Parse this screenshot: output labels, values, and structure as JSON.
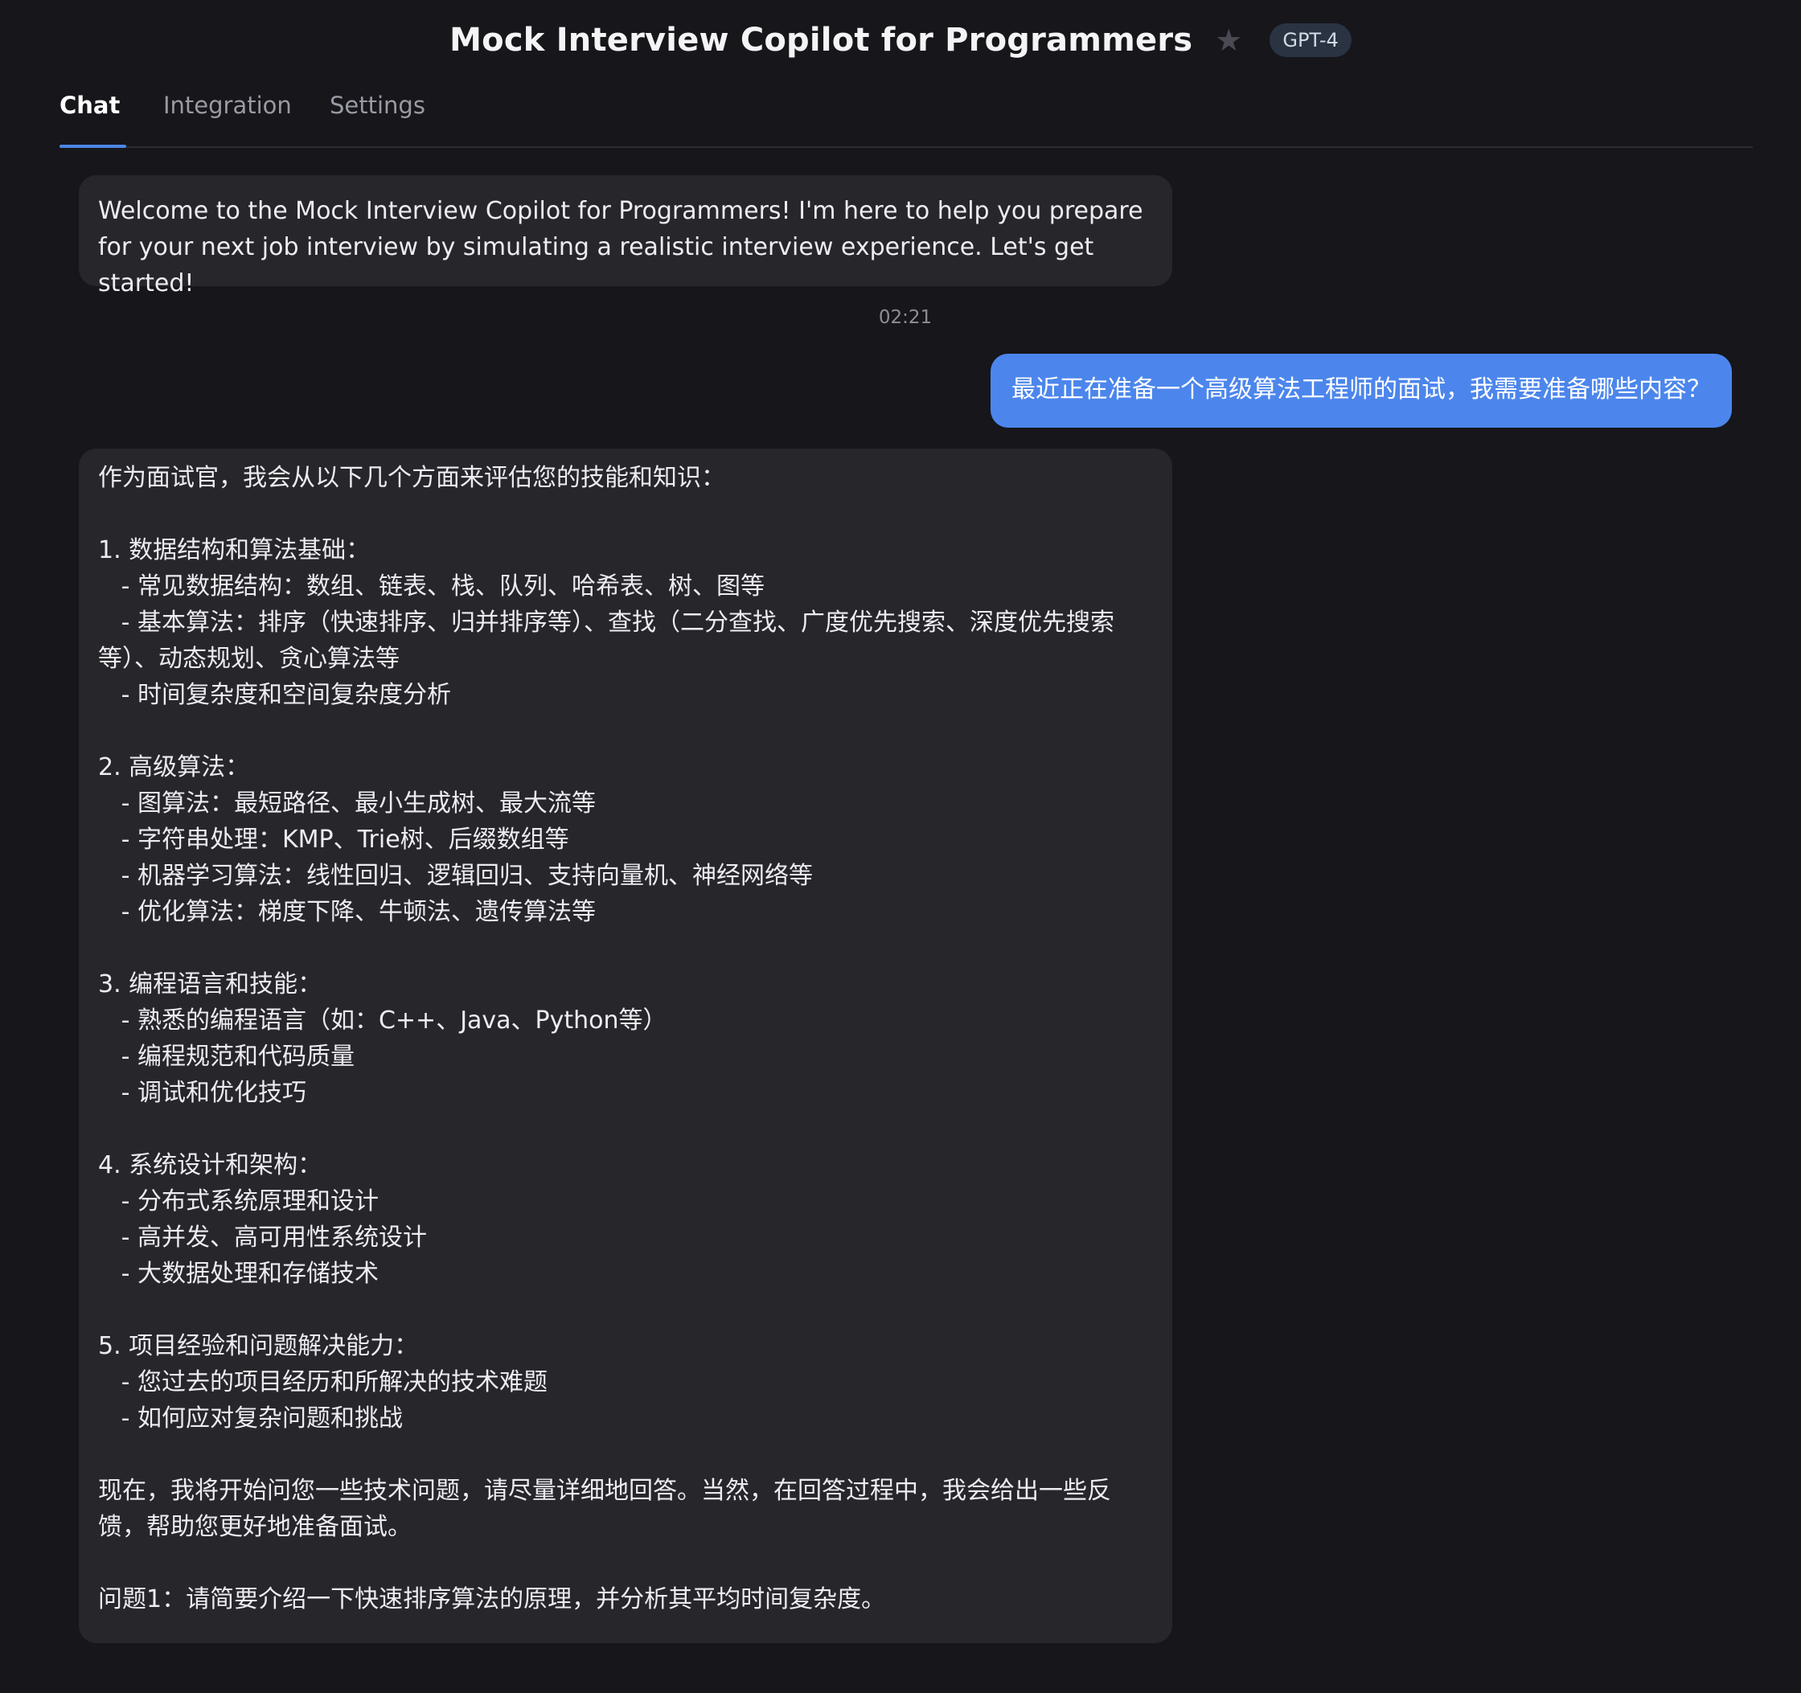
{
  "header": {
    "title": "Mock Interview Copilot for Programmers",
    "model_badge": "GPT-4",
    "star_icon": "star-icon"
  },
  "tabs": [
    {
      "label": "Chat",
      "active": true
    },
    {
      "label": "Integration",
      "active": false
    },
    {
      "label": "Settings",
      "active": false
    }
  ],
  "colors": {
    "background": "#16161b",
    "bot_bubble": "#26262b",
    "user_bubble": "#4c86ec",
    "tab_underline": "#4c86e6"
  },
  "messages": {
    "welcome": "Welcome to the Mock Interview Copilot for Programmers! I'm here to help you prepare for your next job interview by simulating a realistic interview experience. Let's get started!",
    "timestamp": "02:21",
    "user": "最近正在准备一个高级算法工程师的面试，我需要准备哪些内容？",
    "reply": "作为面试官，我会从以下几个方面来评估您的技能和知识：\n\n1. 数据结构和算法基础：\n   - 常见数据结构：数组、链表、栈、队列、哈希表、树、图等\n   - 基本算法：排序（快速排序、归并排序等）、查找（二分查找、广度优先搜索、深度优先搜索等）、动态规划、贪心算法等\n   - 时间复杂度和空间复杂度分析\n\n2. 高级算法：\n   - 图算法：最短路径、最小生成树、最大流等\n   - 字符串处理：KMP、Trie树、后缀数组等\n   - 机器学习算法：线性回归、逻辑回归、支持向量机、神经网络等\n   - 优化算法：梯度下降、牛顿法、遗传算法等\n\n3. 编程语言和技能：\n   - 熟悉的编程语言（如：C++、Java、Python等）\n   - 编程规范和代码质量\n   - 调试和优化技巧\n\n4. 系统设计和架构：\n   - 分布式系统原理和设计\n   - 高并发、高可用性系统设计\n   - 大数据处理和存储技术\n\n5. 项目经验和问题解决能力：\n   - 您过去的项目经历和所解决的技术难题\n   - 如何应对复杂问题和挑战\n\n现在，我将开始问您一些技术问题，请尽量详细地回答。当然，在回答过程中，我会给出一些反馈，帮助您更好地准备面试。\n\n问题1：请简要介绍一下快速排序算法的原理，并分析其平均时间复杂度。"
  }
}
